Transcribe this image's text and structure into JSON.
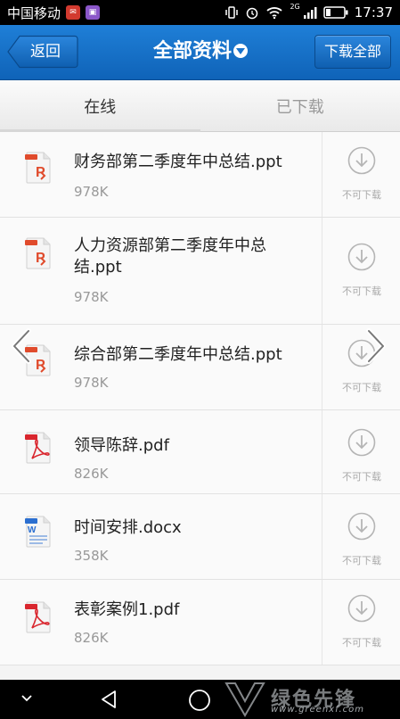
{
  "status_bar": {
    "carrier": "中国移动",
    "network": "2G",
    "time": "17:37"
  },
  "header": {
    "back_label": "返回",
    "title": "全部资料",
    "download_all_label": "下载全部"
  },
  "tabs": [
    {
      "label": "在线",
      "active": true
    },
    {
      "label": "已下载",
      "active": false
    }
  ],
  "files": [
    {
      "name": "财务部第二季度年中总结.ppt",
      "size": "978K",
      "type": "ppt",
      "action_label": "不可下载"
    },
    {
      "name": "人力资源部第二季度年中总结.ppt",
      "size": "978K",
      "type": "ppt",
      "action_label": "不可下载"
    },
    {
      "name": "综合部第二季度年中总结.ppt",
      "size": "978K",
      "type": "ppt",
      "action_label": "不可下载"
    },
    {
      "name": "领导陈辞.pdf",
      "size": "826K",
      "type": "pdf",
      "action_label": "不可下载"
    },
    {
      "name": "时间安排.docx",
      "size": "358K",
      "type": "docx",
      "action_label": "不可下载"
    },
    {
      "name": "表彰案例1.pdf",
      "size": "826K",
      "type": "pdf",
      "action_label": "不可下载"
    }
  ],
  "watermark": {
    "title": "绿色先锋",
    "url": "www.greenxf.com"
  },
  "colors": {
    "header_blue": "#1a73cc",
    "ppt_red": "#e04b2c",
    "pdf_red": "#d9262e",
    "doc_blue": "#2b6fd0"
  }
}
